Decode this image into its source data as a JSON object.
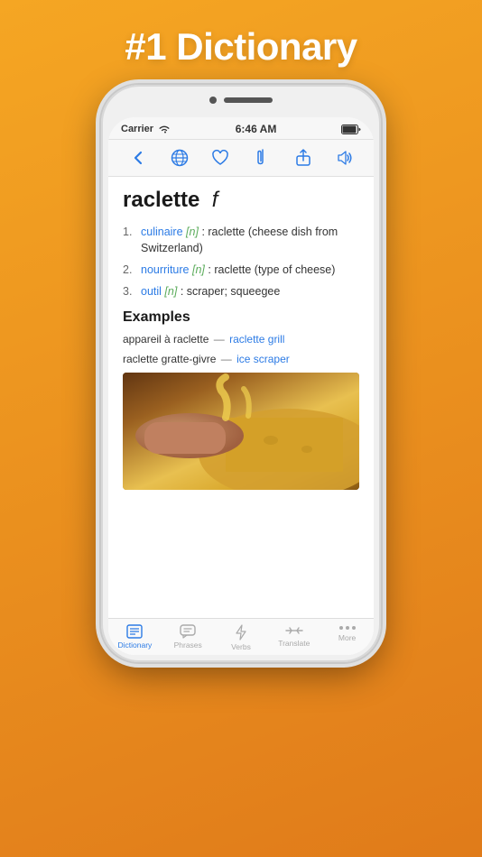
{
  "headline": "#1 Dictionary",
  "status_bar": {
    "carrier": "Carrier",
    "time": "6:46 AM"
  },
  "word": {
    "text": "raclette",
    "pos": "f"
  },
  "definitions": [
    {
      "num": "1.",
      "word": "culinaire",
      "tag": "[n]",
      "text": "raclette (cheese dish from Switzerland)"
    },
    {
      "num": "2.",
      "word": "nourriture",
      "tag": "[n]",
      "text": "raclette (type of cheese)"
    },
    {
      "num": "3.",
      "word": "outil",
      "tag": "[n]",
      "text": "scraper; squeegee"
    }
  ],
  "examples_title": "Examples",
  "examples": [
    {
      "source": "appareil à raclette",
      "dash": "—",
      "translation": "raclette grill"
    },
    {
      "source": "raclette gratte-givre",
      "dash": "—",
      "translation": "ice scraper"
    }
  ],
  "tabs": [
    {
      "label": "Dictionary",
      "icon": "bookmark",
      "active": true
    },
    {
      "label": "Phrases",
      "icon": "chat",
      "active": false
    },
    {
      "label": "Verbs",
      "icon": "lightning",
      "active": false
    },
    {
      "label": "Translate",
      "icon": "arrows",
      "active": false
    },
    {
      "label": "More",
      "icon": "dots",
      "active": false
    }
  ],
  "toolbar": {
    "back": "‹",
    "globe": "🌐",
    "heart": "♡",
    "clip": "📎",
    "share": "⬆",
    "speaker": "🔊"
  },
  "colors": {
    "accent": "#2c7be5",
    "green": "#5aab5a",
    "orange_bg": "#f5a623"
  }
}
